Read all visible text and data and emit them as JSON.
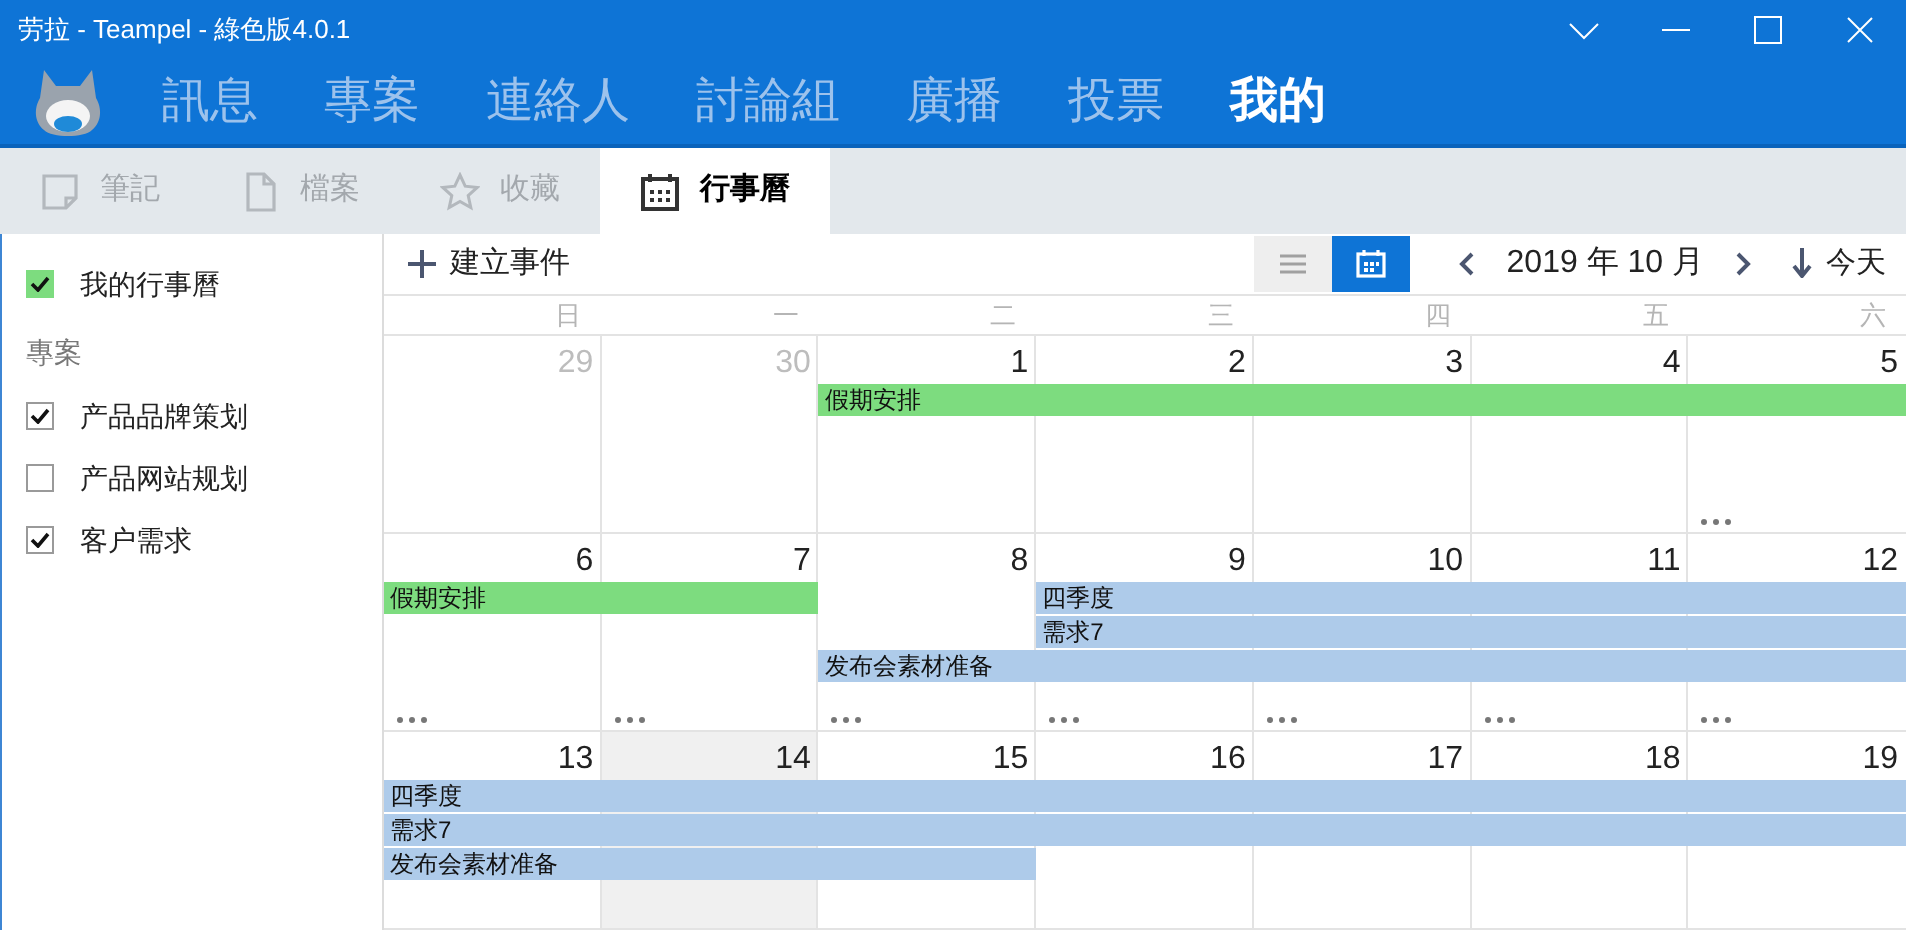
{
  "window": {
    "title": "劳拉 - Teampel - 綠色版4.0.1"
  },
  "nav": [
    {
      "label": "訊息",
      "selected": false
    },
    {
      "label": "專案",
      "selected": false
    },
    {
      "label": "連絡人",
      "selected": false
    },
    {
      "label": "討論組",
      "selected": false
    },
    {
      "label": "廣播",
      "selected": false
    },
    {
      "label": "投票",
      "selected": false
    },
    {
      "label": "我的",
      "selected": true
    }
  ],
  "tabs": [
    {
      "label": "筆記",
      "kind": "note",
      "selected": false
    },
    {
      "label": "檔案",
      "kind": "file",
      "selected": false
    },
    {
      "label": "收藏",
      "kind": "star",
      "selected": false
    },
    {
      "label": "行事曆",
      "kind": "calendar",
      "selected": true
    }
  ],
  "sidebar": {
    "my_calendar": {
      "label": "我的行事曆",
      "checked": true,
      "color": "#7ddc7f"
    },
    "section_title": "專案",
    "projects": [
      {
        "label": "产品品牌策划",
        "checked": true
      },
      {
        "label": "产品网站规划",
        "checked": false
      },
      {
        "label": "客户需求",
        "checked": true
      }
    ]
  },
  "toolbar": {
    "create": "建立事件",
    "views": [
      {
        "kind": "list",
        "selected": false
      },
      {
        "kind": "month",
        "selected": true
      }
    ],
    "month": "2019 年 10 月",
    "today": "今天"
  },
  "weekdays": [
    "日",
    "一",
    "二",
    "三",
    "四",
    "五",
    "六"
  ],
  "weeks": [
    {
      "days": [
        {
          "date": "29",
          "other_month": true,
          "today": false,
          "more": false
        },
        {
          "date": "30",
          "other_month": true,
          "today": false,
          "more": false
        },
        {
          "date": "1",
          "other_month": false,
          "today": false,
          "more": false
        },
        {
          "date": "2",
          "other_month": false,
          "today": false,
          "more": false
        },
        {
          "date": "3",
          "other_month": false,
          "today": false,
          "more": false
        },
        {
          "date": "4",
          "other_month": false,
          "today": false,
          "more": false
        },
        {
          "date": "5",
          "other_month": false,
          "today": false,
          "more": true
        }
      ],
      "lanes": [
        [
          {
            "kind": "empty"
          },
          {
            "kind": "empty"
          },
          {
            "kind": "start",
            "label": "假期安排",
            "color": "#7ddc7f"
          },
          {
            "kind": "continue"
          },
          {
            "kind": "continue"
          },
          {
            "kind": "continue"
          },
          {
            "kind": "continue"
          }
        ]
      ]
    },
    {
      "days": [
        {
          "date": "6",
          "other_month": false,
          "today": false,
          "more": true
        },
        {
          "date": "7",
          "other_month": false,
          "today": false,
          "more": true
        },
        {
          "date": "8",
          "other_month": false,
          "today": false,
          "more": true
        },
        {
          "date": "9",
          "other_month": false,
          "today": false,
          "more": true
        },
        {
          "date": "10",
          "other_month": false,
          "today": false,
          "more": true
        },
        {
          "date": "11",
          "other_month": false,
          "today": false,
          "more": true
        },
        {
          "date": "12",
          "other_month": false,
          "today": false,
          "more": true
        }
      ],
      "lanes": [
        [
          {
            "kind": "start",
            "label": "假期安排",
            "color": "#7ddc7f"
          },
          {
            "kind": "continue"
          },
          {
            "kind": "empty"
          },
          {
            "kind": "start",
            "label": "四季度",
            "color": "#aecbea"
          },
          {
            "kind": "continue"
          },
          {
            "kind": "continue"
          },
          {
            "kind": "continue"
          }
        ],
        [
          {
            "kind": "empty"
          },
          {
            "kind": "empty"
          },
          {
            "kind": "empty"
          },
          {
            "kind": "start",
            "label": "需求7",
            "color": "#aecbea"
          },
          {
            "kind": "continue"
          },
          {
            "kind": "continue"
          },
          {
            "kind": "continue"
          }
        ],
        [
          {
            "kind": "empty"
          },
          {
            "kind": "empty"
          },
          {
            "kind": "start",
            "label": "发布会素材准备",
            "color": "#aecbea"
          },
          {
            "kind": "continue"
          },
          {
            "kind": "continue"
          },
          {
            "kind": "continue"
          },
          {
            "kind": "continue"
          }
        ]
      ]
    },
    {
      "days": [
        {
          "date": "13",
          "other_month": false,
          "today": false,
          "more": false
        },
        {
          "date": "14",
          "other_month": false,
          "today": true,
          "more": false
        },
        {
          "date": "15",
          "other_month": false,
          "today": false,
          "more": false
        },
        {
          "date": "16",
          "other_month": false,
          "today": false,
          "more": false
        },
        {
          "date": "17",
          "other_month": false,
          "today": false,
          "more": false
        },
        {
          "date": "18",
          "other_month": false,
          "today": false,
          "more": false
        },
        {
          "date": "19",
          "other_month": false,
          "today": false,
          "more": false
        }
      ],
      "lanes": [
        [
          {
            "kind": "start",
            "label": "四季度",
            "color": "#aecbea"
          },
          {
            "kind": "continue"
          },
          {
            "kind": "continue"
          },
          {
            "kind": "continue"
          },
          {
            "kind": "continue"
          },
          {
            "kind": "continue"
          },
          {
            "kind": "continue"
          }
        ],
        [
          {
            "kind": "start",
            "label": "需求7",
            "color": "#aecbea"
          },
          {
            "kind": "continue"
          },
          {
            "kind": "continue"
          },
          {
            "kind": "continue"
          },
          {
            "kind": "continue"
          },
          {
            "kind": "continue"
          },
          {
            "kind": "continue"
          }
        ],
        [
          {
            "kind": "start",
            "label": "发布会素材准备",
            "color": "#aecbea"
          },
          {
            "kind": "continue"
          },
          {
            "kind": "continue"
          },
          {
            "kind": "empty"
          },
          {
            "kind": "empty"
          },
          {
            "kind": "empty"
          },
          {
            "kind": "empty"
          }
        ]
      ]
    }
  ]
}
